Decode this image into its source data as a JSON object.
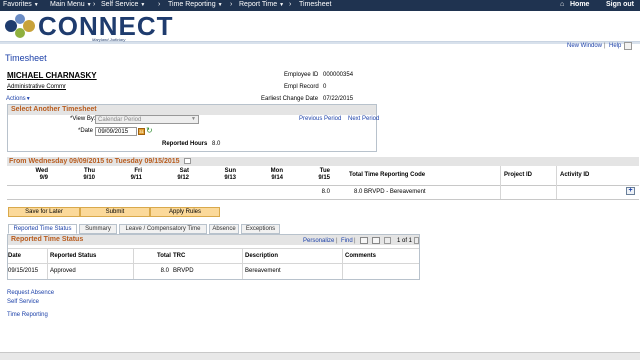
{
  "nav": {
    "favorites": "Favorites",
    "main_menu": "Main Menu",
    "self_service": "Self Service",
    "time_reporting": "Time Reporting",
    "report_time": "Report Time",
    "timesheet": "Timesheet",
    "home": "Home",
    "sign_out": "Sign out"
  },
  "logo": {
    "word": "CONNECT",
    "sub": "Maryland Judiciary"
  },
  "page_links": {
    "new_window": "New Window",
    "help": "Help",
    "sep": "|"
  },
  "page_title": "Timesheet",
  "employee": {
    "name": "MICHAEL CHARNASKY",
    "title": "Administrative Commr",
    "id_label": "Employee ID",
    "id_value": "000000354",
    "empl_record_label": "Empl Record",
    "empl_record_value": "0",
    "change_date_label": "Earliest Change Date",
    "change_date_value": "07/22/2015"
  },
  "actions_label": "Actions",
  "select_timesheet": {
    "header": "Select Another Timesheet",
    "view_by_label": "*View By:",
    "view_by_value": "Calendar Period",
    "date_label": "*Date",
    "date_value": "09/09/2015",
    "previous_period": "Previous Period",
    "next_period": "Next Period",
    "reported_hours_label": "Reported Hours",
    "reported_hours_value": "8.0"
  },
  "timesheet_grid": {
    "header": "From Wednesday 09/09/2015 to Tuesday 09/15/2015",
    "days": [
      {
        "day": "Wed",
        "date": "9/9",
        "hours": ""
      },
      {
        "day": "Thu",
        "date": "9/10",
        "hours": ""
      },
      {
        "day": "Fri",
        "date": "9/11",
        "hours": ""
      },
      {
        "day": "Sat",
        "date": "9/12",
        "hours": ""
      },
      {
        "day": "Sun",
        "date": "9/13",
        "hours": ""
      },
      {
        "day": "Mon",
        "date": "9/14",
        "hours": ""
      },
      {
        "day": "Tue",
        "date": "9/15",
        "hours": "8.0"
      }
    ],
    "col_trc": "Total Time Reporting Code",
    "col_project": "Project ID",
    "col_activity": "Activity ID",
    "row_trc": "8.0 BRVPD - Bereavement",
    "add_row": "+"
  },
  "buttons": {
    "save_for_later": "Save for Later",
    "submit": "Submit",
    "apply_rules": "Apply Rules"
  },
  "tabs": [
    {
      "label": "Reported Time Status",
      "active": true
    },
    {
      "label": "Summary",
      "active": false
    },
    {
      "label": "Leave / Compensatory Time",
      "active": false
    },
    {
      "label": "Absence",
      "active": false
    },
    {
      "label": "Exceptions",
      "active": false
    }
  ],
  "status_panel": {
    "header": "Reported Time Status",
    "personalize": "Personalize",
    "find": "Find",
    "sep": "|",
    "page_info": "1 of 1",
    "columns": {
      "date": "Date",
      "status": "Reported Status",
      "total": "Total",
      "trc": "TRC",
      "description": "Description",
      "comments": "Comments"
    },
    "rows": [
      {
        "date": "09/15/2015",
        "status": "Approved",
        "total": "8.0",
        "trc": "BRVPD",
        "description": "Bereavement",
        "comments": ""
      }
    ]
  },
  "bottom_links": {
    "request_absence": "Request Absence",
    "self_service": "Self Service",
    "time_reporting": "Time Reporting"
  },
  "colors": {
    "nav": "#1f3350",
    "link": "#1a3fa8",
    "section_header": "#b85c1e",
    "button": "#fbd99a"
  }
}
